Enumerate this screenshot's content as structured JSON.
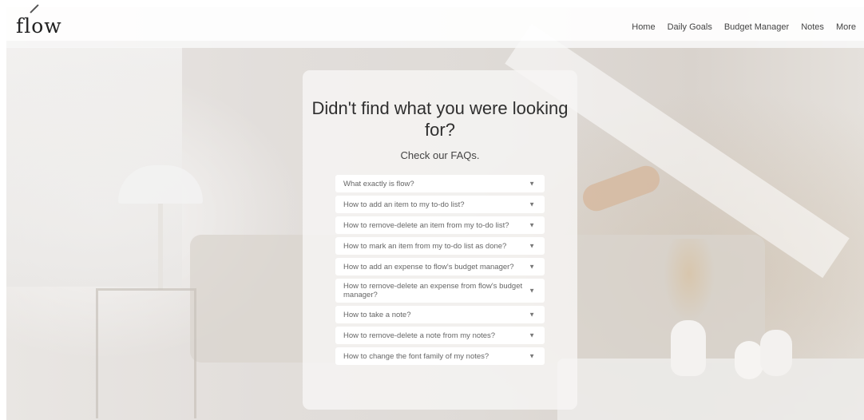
{
  "logo": {
    "text": "flow"
  },
  "nav": {
    "items": [
      "Home",
      "Daily Goals",
      "Budget Manager",
      "Notes",
      "More"
    ]
  },
  "faq": {
    "title": "Didn't find what you were looking for?",
    "subtitle": "Check our FAQs.",
    "questions": [
      "What exactly is flow?",
      "How to add an item to my to-do list?",
      "How to remove-delete an item from my to-do list?",
      "How to mark an item from my to-do list as done?",
      "How to add an expense to flow's budget manager?",
      "How to remove-delete an expense from flow's budget manager?",
      "How to take a note?",
      "How to remove-delete a note from my notes?",
      "How to change the font family of my notes?"
    ],
    "arrow_icon": "▼"
  },
  "colors": {
    "panel": "#f6f5f4",
    "text": "#2f2f2f",
    "item_bg": "#ffffff"
  }
}
